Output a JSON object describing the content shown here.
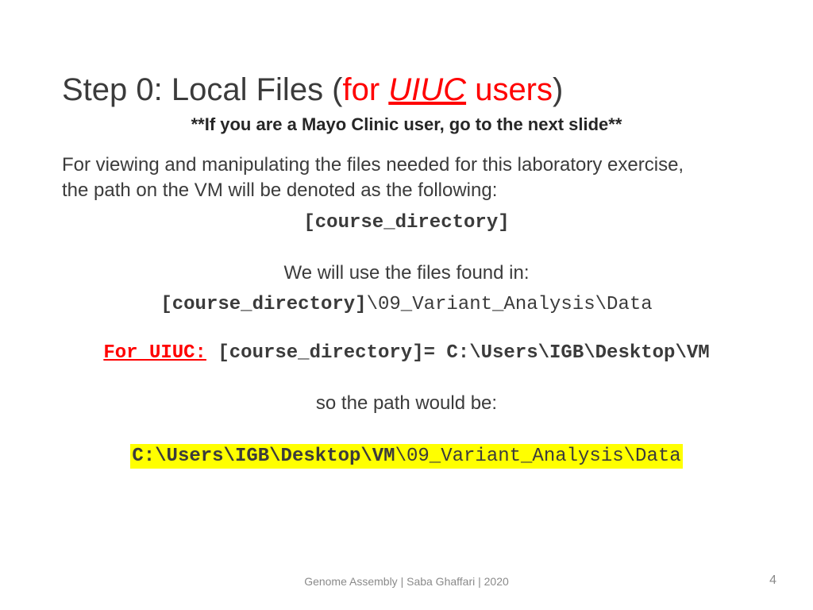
{
  "title": {
    "prefix": "Step 0: Local Files (",
    "red1": "for ",
    "uiuc": "UIUC",
    "red2": " users",
    "suffix": ")"
  },
  "subtitle": "**If you are a Mayo Clinic user, go to the next slide**",
  "intro1": "For viewing and manipulating the files needed for this laboratory exercise,",
  "intro2": "the path on the VM will be denoted as the following:",
  "course_dir_placeholder": "[course_directory]",
  "use_files": "We will use the files found in:",
  "path1_prefix": "[course_directory]",
  "path1_suffix": "\\09_Variant_Analysis\\Data",
  "for_uiuc": "For UIUC:",
  "equals_line": " [course_directory]= C:\\Users\\IGB\\Desktop\\VM",
  "so_path": "so the path would be:",
  "final_prefix": "C:\\Users\\IGB\\Desktop\\VM",
  "final_suffix": "\\09_Variant_Analysis\\Data",
  "footer": "Genome Assembly | Saba Ghaffari | 2020",
  "page": "4"
}
